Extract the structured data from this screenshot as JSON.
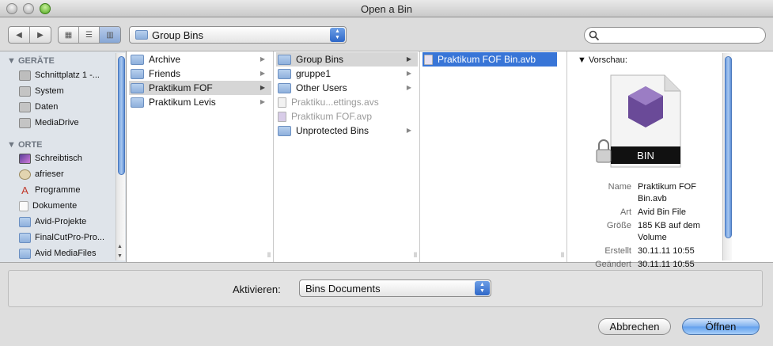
{
  "window": {
    "title": "Open a Bin"
  },
  "toolbar": {
    "path_popup": "Group Bins",
    "search_placeholder": ""
  },
  "sidebar": {
    "devices_header": "GERÄTE",
    "devices": [
      "Schnittplatz 1 -...",
      "System",
      "Daten",
      "MediaDrive"
    ],
    "places_header": "ORTE",
    "places": [
      "Schreibtisch",
      "afrieser",
      "Programme",
      "Dokumente",
      "Avid-Projekte",
      "FinalCutPro-Pro...",
      "Avid MediaFiles"
    ]
  },
  "columns": {
    "col1": [
      "Archive",
      "Friends",
      "Praktikum FOF",
      "Praktikum Levis"
    ],
    "col2": [
      "Group Bins",
      "gruppe1",
      "Other Users",
      "Praktiku...ettings.avs",
      "Praktikum FOF.avp",
      "Unprotected Bins"
    ],
    "col3": [
      "Praktikum FOF Bin.avb"
    ]
  },
  "preview": {
    "header": "Vorschau:",
    "icon_label": "BIN",
    "fields": [
      {
        "key": "Name",
        "value": "Praktikum FOF Bin.avb"
      },
      {
        "key": "Art",
        "value": "Avid Bin File"
      },
      {
        "key": "Größe",
        "value": "185 KB auf dem Volume"
      },
      {
        "key": "Erstellt",
        "value": "30.11.11 10:55"
      },
      {
        "key": "Geändert",
        "value": "30.11.11 10:55"
      }
    ]
  },
  "filter": {
    "label": "Aktivieren:",
    "value": "Bins Documents"
  },
  "buttons": {
    "cancel": "Abbrechen",
    "open": "Öffnen"
  },
  "colors": {
    "selection": "#3875d7",
    "accent": "#62a0ee"
  }
}
